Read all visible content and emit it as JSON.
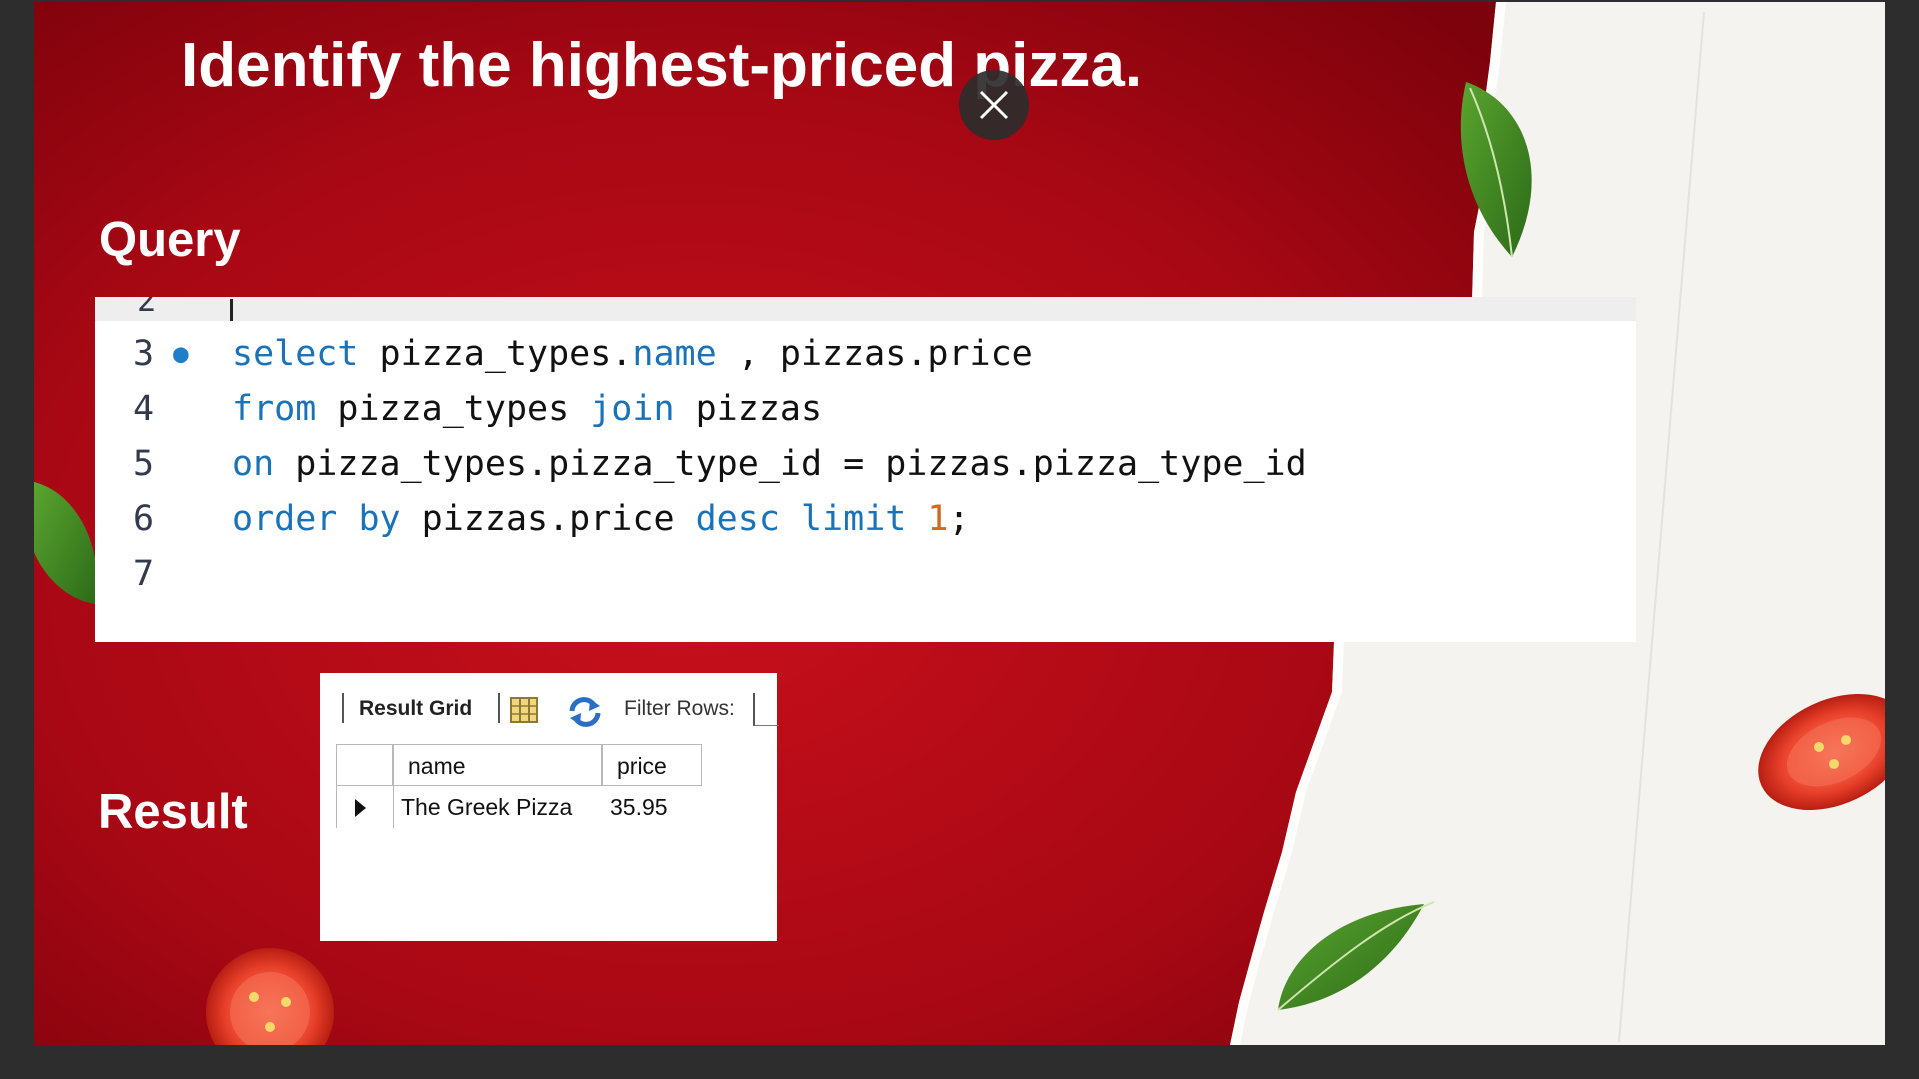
{
  "slide": {
    "title": "Identify the highest-priced pizza.",
    "query_label": "Query",
    "result_label": "Result"
  },
  "code": {
    "partial_line_number": "2",
    "lines": [
      {
        "number": "3",
        "has_breakpoint": true
      },
      {
        "number": "4",
        "has_breakpoint": false
      },
      {
        "number": "5",
        "has_breakpoint": false
      },
      {
        "number": "6",
        "has_breakpoint": false
      },
      {
        "number": "7",
        "has_breakpoint": false
      }
    ],
    "tokens": {
      "l3_select": "select",
      "l3_a": " pizza_types.",
      "l3_name": "name",
      "l3_b": " , pizzas.price",
      "l4_from": "from",
      "l4_a": " pizza_types ",
      "l4_join": "join",
      "l4_b": " pizzas",
      "l5_on": "on",
      "l5_a": " pizza_types.pizza_type_id = pizzas.pizza_type_id",
      "l6_order": "order",
      "l6_sp1": " ",
      "l6_by": "by",
      "l6_a": " pizzas.price ",
      "l6_desc": "desc",
      "l6_sp2": " ",
      "l6_limit": "limit",
      "l6_sp3": " ",
      "l6_num": "1",
      "l6_semi": ";"
    }
  },
  "result_grid": {
    "tab_label": "Result Grid",
    "filter_label": "Filter Rows:",
    "columns": [
      "name",
      "price"
    ],
    "rows": [
      {
        "name": "The Greek Pizza",
        "price": "35.95"
      }
    ]
  },
  "colors": {
    "red": "#b00a16",
    "keyword": "#1a72b8",
    "number": "#d2691e"
  }
}
